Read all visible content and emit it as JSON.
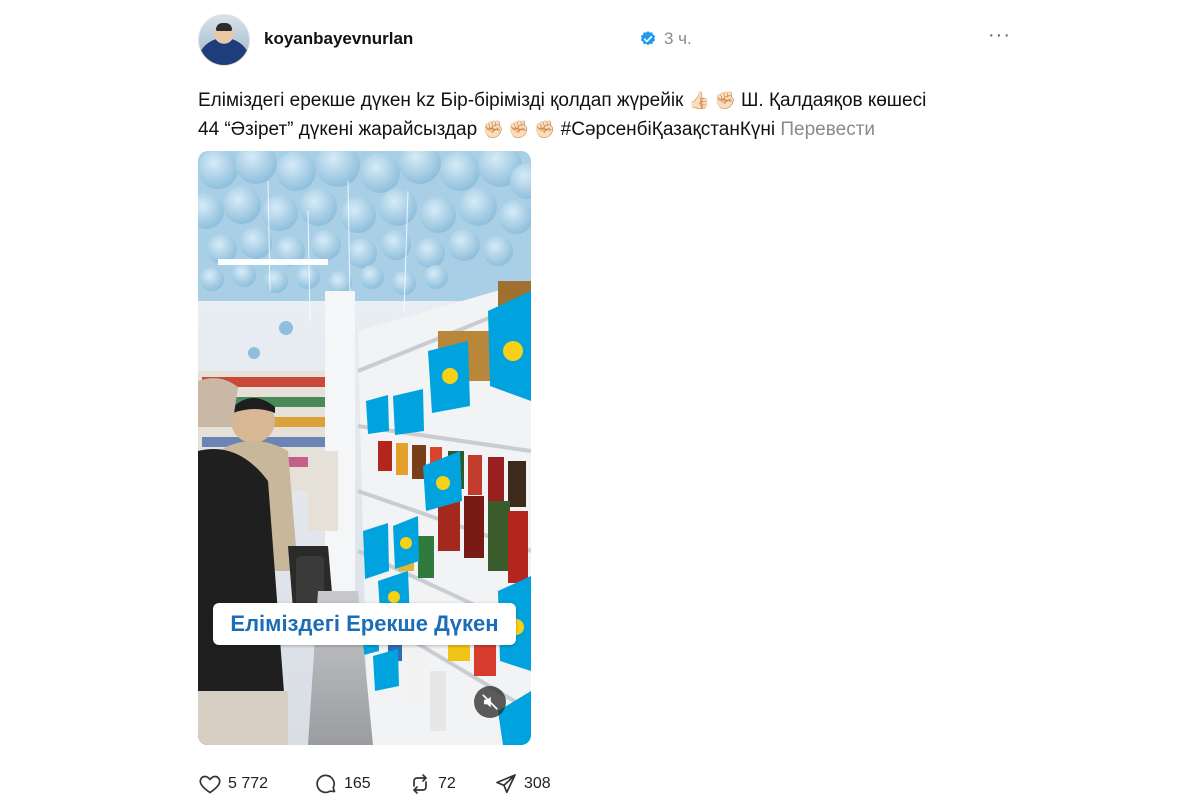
{
  "post": {
    "username": "koyanbayevnurlan",
    "time": "3 ч.",
    "more_label": "···",
    "caption_line1_text": "Еліміздегі ерекше дүкен kz Бір-бірімізді қолдап жүрейік",
    "caption_line1_emoji": "👍🏻 ✊🏻",
    "caption_line1_tail": "Ш. Қалдаяқов көшесі",
    "caption_line2_text": "44 “Әзірет” дүкені жарайсыздар",
    "caption_line2_emoji": "✊🏻 ✊🏻 ✊🏻",
    "hashtag": "#СәрсенбіҚазақстанКүні",
    "translate_label": "Перевести",
    "video_overlay_text": "Еліміздегі Ерекше Дүкен"
  },
  "actions": {
    "likes": "5 772",
    "comments": "165",
    "reposts": "72",
    "shares": "308"
  },
  "icons": {
    "verified": "verified-badge-icon",
    "like": "heart-icon",
    "comment": "comment-icon",
    "repost": "repost-icon",
    "share": "send-icon",
    "mute": "muted-speaker-icon"
  },
  "colors": {
    "verified_blue": "#1d9bf0",
    "overlay_text": "#1b6eb5",
    "muted_text": "#8a8a8a"
  }
}
